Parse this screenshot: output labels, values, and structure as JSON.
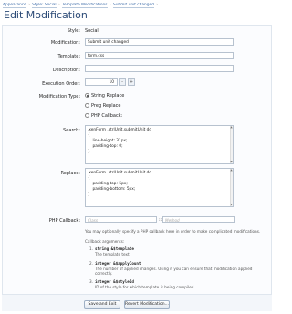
{
  "breadcrumb": {
    "items": [
      "Appearance",
      "Style: Social",
      "Template Modifications",
      "Submit unit changed"
    ],
    "separator": "›"
  },
  "page_title": "Edit Modification",
  "form": {
    "style": {
      "label": "Style:",
      "value": "Social"
    },
    "modification": {
      "label": "Modification:",
      "value": "Submit unit changed"
    },
    "template": {
      "label": "Template:",
      "value": "form.css"
    },
    "description": {
      "label": "Description:",
      "value": ""
    },
    "execution_order": {
      "label": "Execution Order:",
      "value": "10",
      "minus": "-",
      "plus": "+"
    },
    "modification_type": {
      "label": "Modification Type:",
      "options": [
        "String Replace",
        "Preg Replace",
        "PHP Callback:"
      ],
      "selected": 0
    },
    "search": {
      "label": "Search:",
      "lines": [
        ".xenForm .ctrlUnit.submitUnit dd",
        "{",
        "    line-height: 31px;",
        "    padding-top: 0;",
        "}"
      ]
    },
    "replace": {
      "label": "Replace:",
      "lines": [
        ".xenForm .ctrlUnit.submitUnit dd",
        "{",
        "    padding-top: 5px;",
        "    padding-bottom: 5px;",
        "}"
      ]
    },
    "php_callback": {
      "label": "PHP Callback:",
      "class_placeholder": "Class",
      "method_placeholder": "Method",
      "separator": "::",
      "hint": "You may optionally specify a PHP callback here in order to make complicated modifications.",
      "args_title": "Callback arguments:",
      "args": [
        {
          "n": "1.",
          "sig": "string &$template",
          "desc": "The template text.",
          "desc2": ""
        },
        {
          "n": "2.",
          "sig": "integer &$applyCount",
          "desc": "The number of applied changes. Using it you can ensure that modification applied",
          "desc2": "correctly."
        },
        {
          "n": "3.",
          "sig": "integer &$styleId",
          "desc": "ID of the style for which template is being compiled.",
          "desc2": ""
        }
      ]
    }
  },
  "buttons": {
    "save": "Save and Exit",
    "revert": "Revert Modification..."
  },
  "colors": {
    "title": "#2b4a76",
    "link": "#3a6aa8",
    "border": "#b7c2cf"
  }
}
